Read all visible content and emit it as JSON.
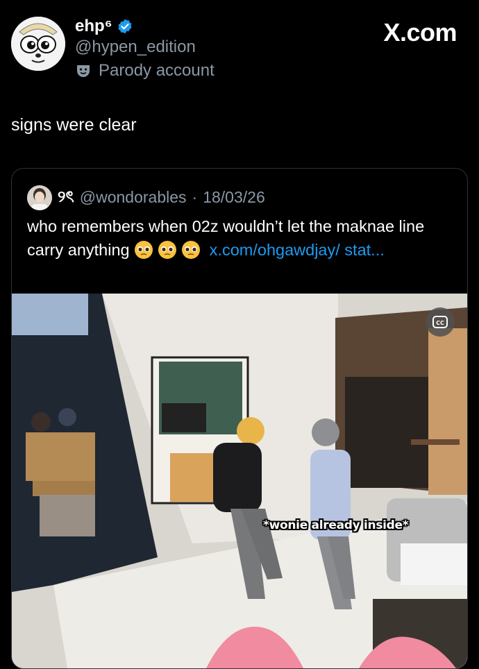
{
  "author": {
    "name": "ehp⁶",
    "handle": "@hypen_edition",
    "parody_label": "Parody account"
  },
  "brand": "X.com",
  "tweet": {
    "text": "signs were clear"
  },
  "quoted_post": {
    "display_name": "୨ৎ",
    "handle": "@wondorables",
    "separator": "·",
    "date": "18/03/26",
    "text": "who remembers when 02z wouldn’t let the maknae line carry anything",
    "link_text": "x.com/ohgawdjay/",
    "link_text_2": "stat..."
  },
  "video": {
    "subtitle": "*wonie already inside*",
    "cc_icon": "cc-icon"
  },
  "colors": {
    "background": "#000000",
    "link": "#1d9bf0",
    "muted": "#8b98a5",
    "verified": "#1d9bf0"
  }
}
